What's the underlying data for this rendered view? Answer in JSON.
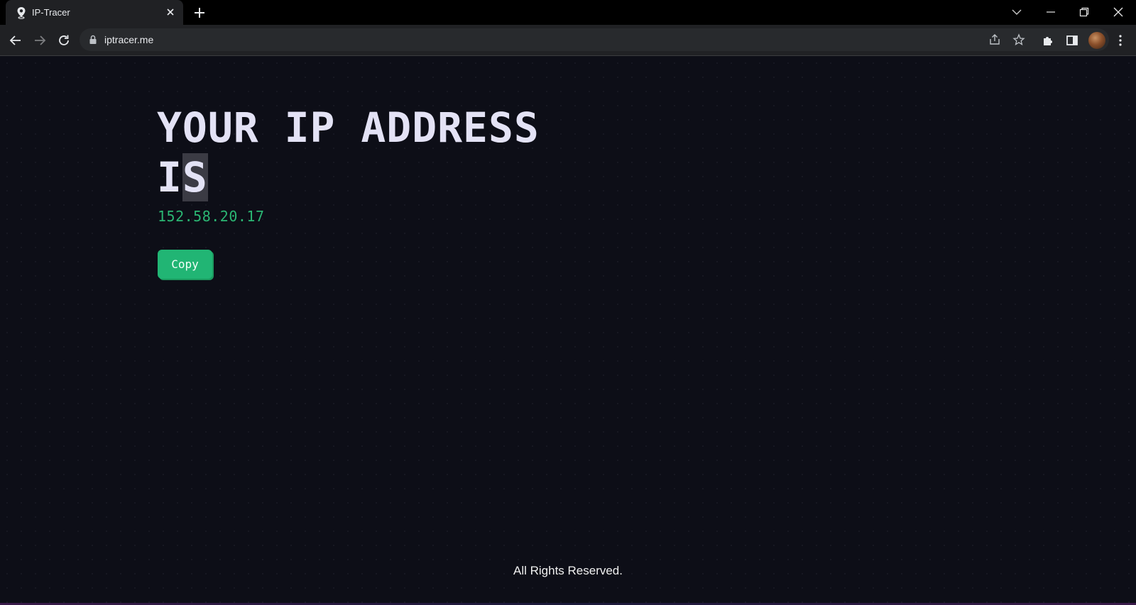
{
  "browser": {
    "tab": {
      "title": "IP-Tracer"
    },
    "address_bar": {
      "url": "iptracer.me"
    }
  },
  "page": {
    "heading_line1": "YOUR IP ADDRESS",
    "heading_line2_a": "I",
    "heading_line2_b": "S",
    "ip_address": "152.58.20.17",
    "copy_label": "Copy",
    "footer_text": "All Rights Reserved."
  },
  "colors": {
    "background": "#0d0e17",
    "heading": "#e3e2f5",
    "ip_green": "#2bb673",
    "button_green": "#21b574"
  }
}
